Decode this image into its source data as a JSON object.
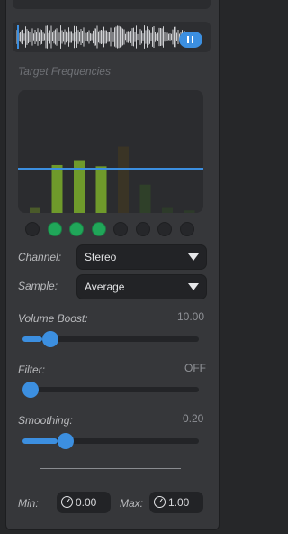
{
  "target_frequencies": {
    "label": "Target Frequencies"
  },
  "spectrum": {
    "bars": [
      {
        "level": 0.04,
        "color": "#4a5a2a"
      },
      {
        "level": 0.39,
        "color": "#6f9a2b"
      },
      {
        "level": 0.43,
        "color": "#6f9a2b"
      },
      {
        "level": 0.38,
        "color": "#6f9a2b"
      },
      {
        "level": 0.54,
        "color": "#3a3425"
      },
      {
        "level": 0.23,
        "color": "#2f4029"
      },
      {
        "level": 0.04,
        "color": "#2d3a2a"
      },
      {
        "level": 0.02,
        "color": "#2d3a2a"
      }
    ],
    "threshold": 0.36,
    "threshold_color": "#3c8fe0"
  },
  "band_toggles": [
    false,
    true,
    true,
    true,
    false,
    false,
    false,
    false
  ],
  "channel": {
    "label": "Channel:",
    "value": "Stereo"
  },
  "sample": {
    "label": "Sample:",
    "value": "Average"
  },
  "volume_boost": {
    "label": "Volume Boost:",
    "value_text": "10.00",
    "level": 0.11
  },
  "filter": {
    "label": "Filter:",
    "value_text": "OFF",
    "level": 0.0
  },
  "smoothing": {
    "label": "Smoothing:",
    "value_text": "0.20",
    "level": 0.2
  },
  "min": {
    "label": "Min:",
    "value": "0.00"
  },
  "max": {
    "label": "Max:",
    "value": "1.00"
  },
  "accent_color": "#3c8fe0"
}
